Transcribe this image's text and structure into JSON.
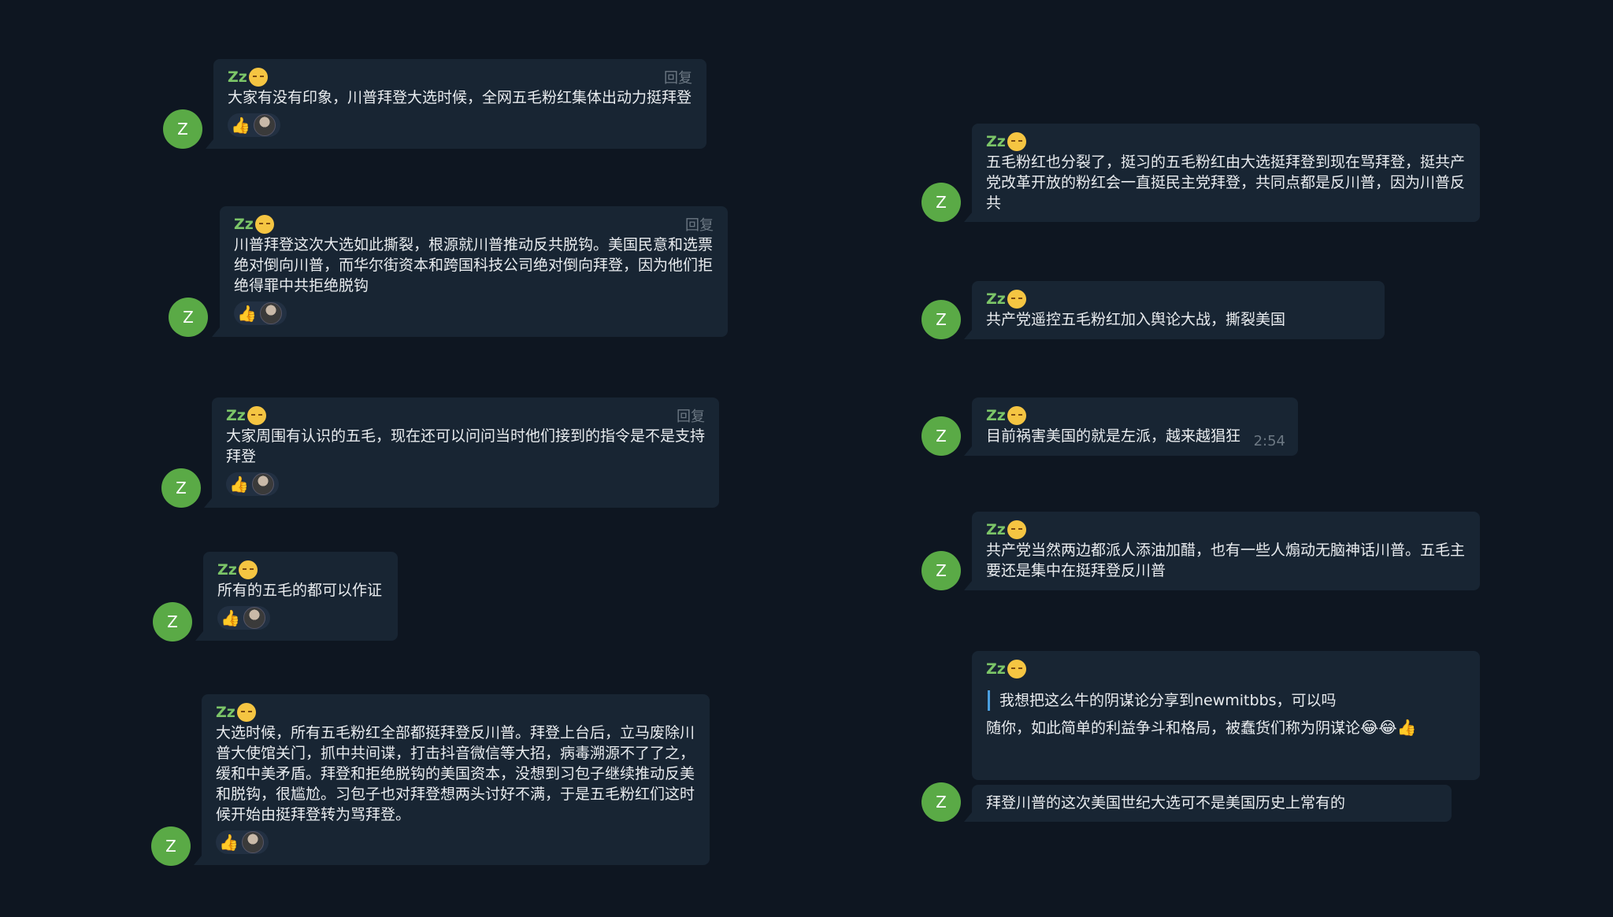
{
  "messages": [
    {
      "sender": "Zz",
      "text": "大家有没有印象，川普拜登大选时候，全网五毛粉红集体出动力挺拜登",
      "reply_label": "回复",
      "reaction": "👍",
      "avatar_letter": "Z"
    },
    {
      "sender": "Zz",
      "text": "川普拜登这次大选如此撕裂，根源就川普推动反共脱钩。美国民意和选票绝对倒向川普，而华尔街资本和跨国科技公司绝对倒向拜登，因为他们拒绝得罪中共拒绝脱钩",
      "reply_label": "回复",
      "reaction": "👍",
      "avatar_letter": "Z"
    },
    {
      "sender": "Zz",
      "text": "大家周围有认识的五毛，现在还可以问问当时他们接到的指令是不是支持拜登",
      "reply_label": "回复",
      "reaction": "👍",
      "avatar_letter": "Z"
    },
    {
      "sender": "Zz",
      "text": "所有的五毛的都可以作证",
      "reaction": "👍",
      "avatar_letter": "Z"
    },
    {
      "sender": "Zz",
      "text": "大选时候，所有五毛粉红全部都挺拜登反川普。拜登上台后，立马废除川普大使馆关门，抓中共间谍，打击抖音微信等大招，病毒溯源不了了之，缓和中美矛盾。拜登和拒绝脱钩的美国资本，没想到习包子继续推动反美和脱钩，很尴尬。习包子也对拜登想两头讨好不满，于是五毛粉红们这时候开始由挺拜登转为骂拜登。",
      "reaction": "👍",
      "avatar_letter": "Z"
    },
    {
      "sender": "Zz",
      "text": "五毛粉红也分裂了，挺习的五毛粉红由大选挺拜登到现在骂拜登，挺共产党改革开放的粉红会一直挺民主党拜登，共同点都是反川普，因为川普反共",
      "avatar_letter": "Z"
    },
    {
      "sender": "Zz",
      "text": "共产党遥控五毛粉红加入舆论大战，撕裂美国",
      "avatar_letter": "Z"
    },
    {
      "sender": "Zz",
      "text": "目前祸害美国的就是左派，越来越猖狂",
      "time": "2:54",
      "avatar_letter": "Z"
    },
    {
      "sender": "Zz",
      "text": "共产党当然两边都派人添油加醋，也有一些人煽动无脑神话川普。五毛主要还是集中在挺拜登反川普",
      "avatar_letter": "Z"
    },
    {
      "sender": "Zz",
      "quote": "我想把这么牛的阴谋论分享到newmitbbs，可以吗",
      "text": "随你，如此简单的利益争斗和格局，被蠢货们称为阴谋论",
      "emojis": "😂😂👍",
      "avatar_letter": "Z"
    },
    {
      "text": "拜登川普的这次美国世纪大选可不是美国历史上常有的",
      "avatar_letter": "Z"
    }
  ],
  "colors": {
    "background": "#0e1621",
    "bubble": "#182533",
    "sender": "#7cc568",
    "avatar": "#5aaa46",
    "quote_bar": "#4a9fe0"
  },
  "icons": {
    "sender_status": "sleeping-face-icon",
    "reaction": "thumbs-up-icon",
    "reactor": "reactor-avatar"
  }
}
